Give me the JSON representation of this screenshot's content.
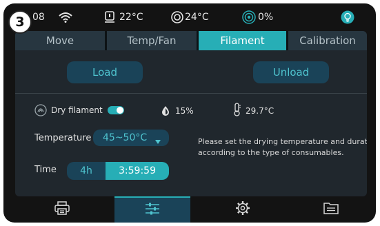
{
  "step_badge": "3",
  "status_bar": {
    "time_partial": "08",
    "bed_temp": "22°C",
    "chamber_temp": "24°C",
    "fan_percent": "0%",
    "icons": [
      "wifi-icon",
      "bed-temperature-icon",
      "chamber-temperature-icon",
      "fan-icon",
      "light-bulb-icon"
    ]
  },
  "tabs": [
    {
      "label": "Move",
      "active": false
    },
    {
      "label": "Temp/Fan",
      "active": false
    },
    {
      "label": "Filament",
      "active": true
    },
    {
      "label": "Calibration",
      "active": false
    }
  ],
  "buttons": {
    "load": "Load",
    "unload": "Unload"
  },
  "dry": {
    "label": "Dry filament",
    "enabled": true,
    "humidity": "15%",
    "temperature": "29.7°C"
  },
  "temperature": {
    "label": "Temperature",
    "value": "45~50°C"
  },
  "time": {
    "label": "Time",
    "option_hours": "4h",
    "value": "3:59:59"
  },
  "hint": {
    "line1": "Please set the drying temperature and duration",
    "line2": "according to the type of consumables."
  },
  "nav": [
    {
      "icon": "printer-icon",
      "active": false
    },
    {
      "icon": "sliders-icon",
      "active": true
    },
    {
      "icon": "gear-icon",
      "active": false
    },
    {
      "icon": "folder-icon",
      "active": false
    }
  ],
  "colors": {
    "accent": "#27aeb6",
    "panel": "#20272d",
    "button": "#1a4358",
    "button_text": "#4fc4cf",
    "background": "#131313"
  }
}
